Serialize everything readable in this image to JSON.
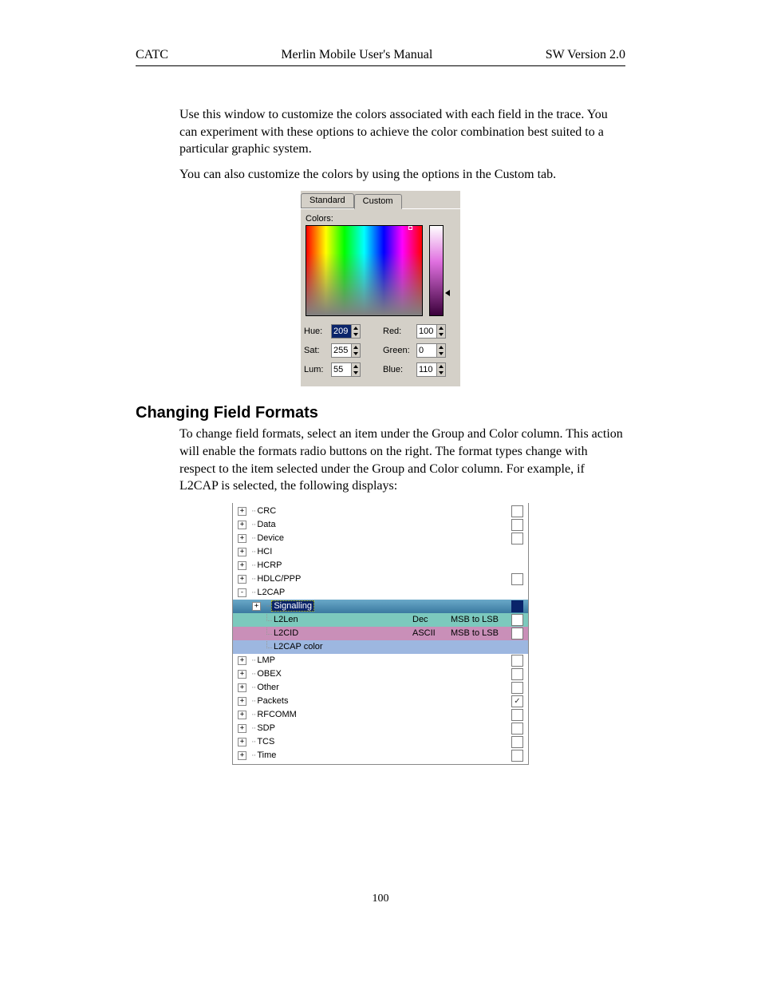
{
  "header": {
    "left": "CATC",
    "center": "Merlin Mobile User's Manual",
    "right": "SW Version 2.0"
  },
  "paragraphs": {
    "p1": "Use this window to customize the colors associated with each field in the trace.  You can experiment with these options to achieve the color combination best suited to a particular graphic system.",
    "p2": "You can also customize the colors by using the options in the Custom tab."
  },
  "section_heading": "Changing Field Formats",
  "paragraphs2": {
    "p3": "To change field formats, select an item under the Group and Color column.  This action will enable the formats radio buttons on the right.  The format types change with respect to the item selected under the Group and Color column.  For example, if L2CAP is selected, the following displays:"
  },
  "color_picker": {
    "tabs": {
      "standard": "Standard",
      "custom": "Custom"
    },
    "colors_label": "Colors:",
    "fields": {
      "hue": {
        "label": "Hue:",
        "value": "209"
      },
      "sat": {
        "label": "Sat:",
        "value": "255"
      },
      "lum": {
        "label": "Lum:",
        "value": "55"
      },
      "red": {
        "label": "Red:",
        "value": "100"
      },
      "green": {
        "label": "Green:",
        "value": "0"
      },
      "blue": {
        "label": "Blue:",
        "value": "110"
      }
    }
  },
  "tree": {
    "items": [
      {
        "label": "CRC",
        "exp": "+",
        "chk": true
      },
      {
        "label": "Data",
        "exp": "+",
        "chk": true
      },
      {
        "label": "Device",
        "exp": "+",
        "chk": true
      },
      {
        "label": "HCI",
        "exp": "+",
        "chk": false
      },
      {
        "label": "HCRP",
        "exp": "+",
        "chk": false
      },
      {
        "label": "HDLC/PPP",
        "exp": "+",
        "chk": true
      },
      {
        "label": "L2CAP",
        "exp": "-",
        "chk": false
      },
      {
        "label": "LMP",
        "exp": "+",
        "chk": true
      },
      {
        "label": "OBEX",
        "exp": "+",
        "chk": true
      },
      {
        "label": "Other",
        "exp": "+",
        "chk": true
      },
      {
        "label": "Packets",
        "exp": "+",
        "chk": true,
        "checked": true
      },
      {
        "label": "RFCOMM",
        "exp": "+",
        "chk": true
      },
      {
        "label": "SDP",
        "exp": "+",
        "chk": true
      },
      {
        "label": "TCS",
        "exp": "+",
        "chk": true
      },
      {
        "label": "Time",
        "exp": "+",
        "chk": true
      }
    ],
    "l2cap_children": {
      "signalling": "Signalling",
      "l2len": {
        "label": "L2Len",
        "fmt": "Dec",
        "order": "MSB to LSB"
      },
      "l2cid": {
        "label": "L2CID",
        "fmt": "ASCII",
        "order": "MSB to LSB"
      },
      "l2col": {
        "label": "L2CAP color"
      }
    }
  },
  "page_number": "100"
}
